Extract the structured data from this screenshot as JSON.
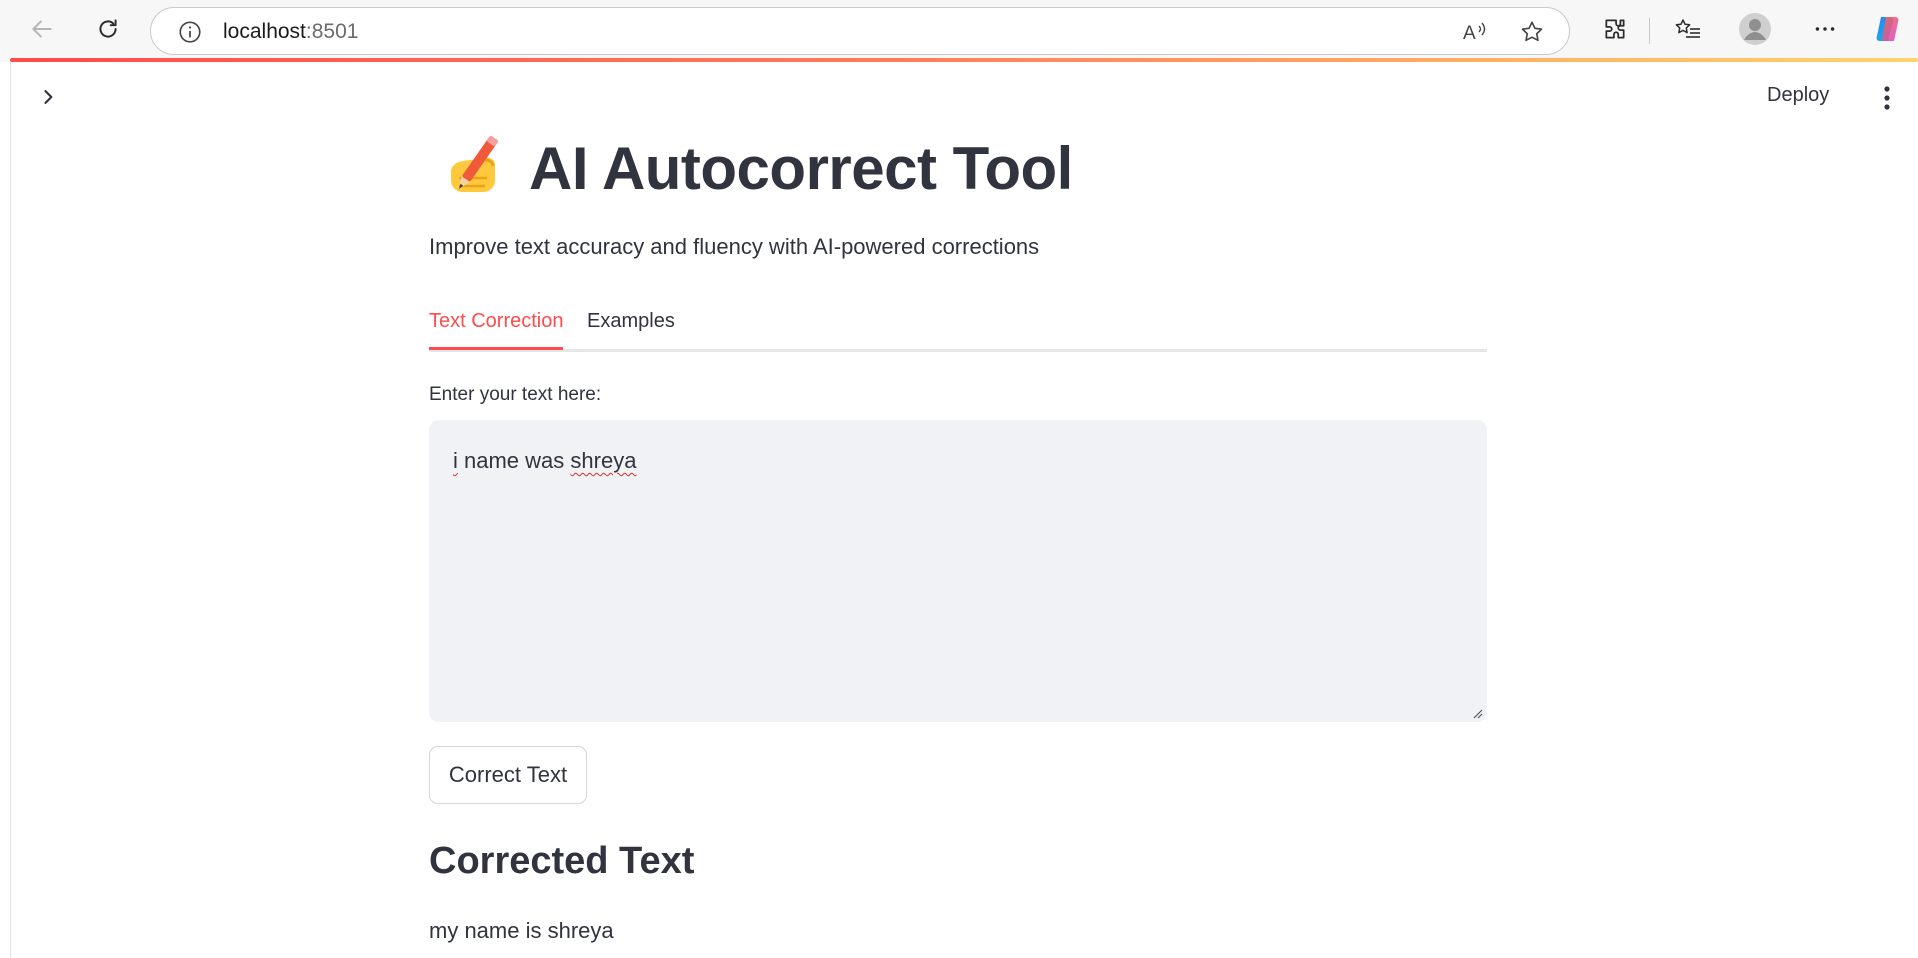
{
  "browser": {
    "url_host": "localhost",
    "url_port": ":8501",
    "icons": [
      "back-arrow-icon",
      "reload-icon",
      "site-info-icon",
      "read-aloud-icon",
      "favorite-star-icon",
      "extensions-icon",
      "favorites-icon",
      "profile-icon",
      "more-icon",
      "copilot-icon"
    ],
    "gradient_colors": [
      "#ff4b4b",
      "#ffd36b"
    ]
  },
  "app": {
    "header": {
      "deploy_label": "Deploy"
    },
    "title": "AI Autocorrect Tool",
    "title_emoji": "✍️",
    "subtitle": "Improve text accuracy and fluency with AI-powered corrections",
    "tabs": [
      {
        "label": "Text Correction",
        "active": true
      },
      {
        "label": "Examples",
        "active": false
      }
    ],
    "input": {
      "label": "Enter your text here:",
      "words": [
        "i",
        " name was ",
        "shreya"
      ]
    },
    "button_label": "Correct Text",
    "result": {
      "heading": "Corrected Text",
      "text": "my name is shreya"
    },
    "accent_color": "#ff4b4b"
  }
}
